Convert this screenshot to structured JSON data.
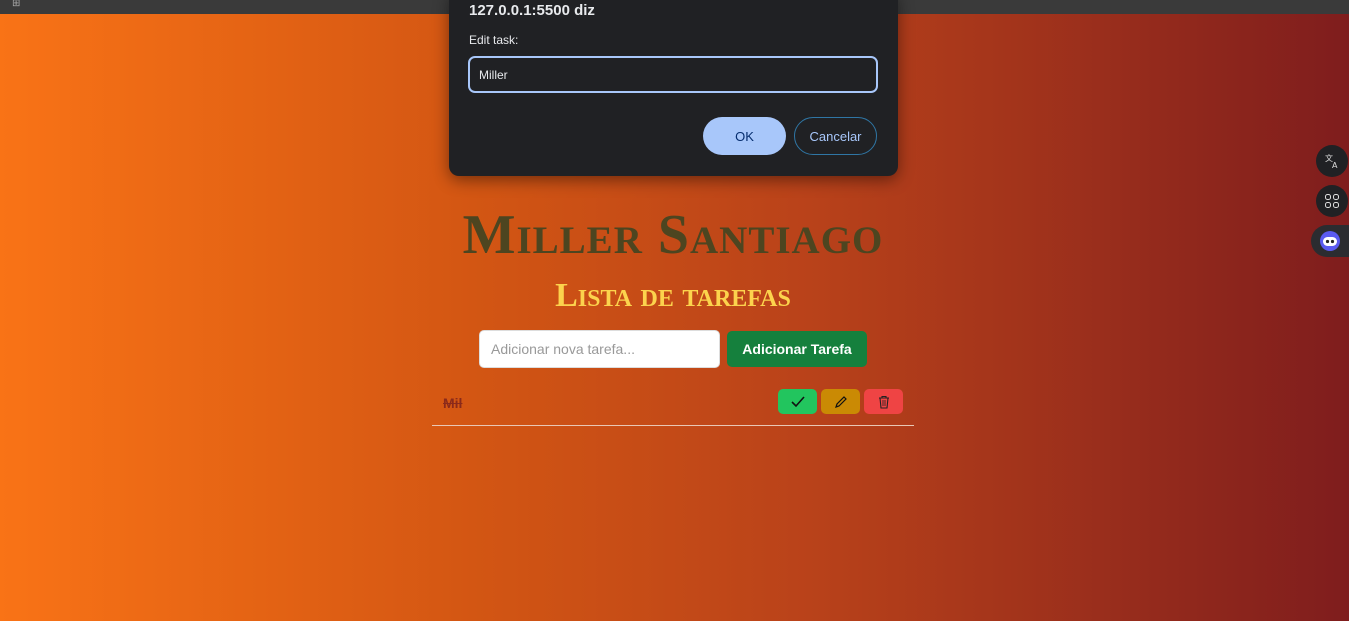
{
  "dialog": {
    "title": "127.0.0.1:5500 diz",
    "label": "Edit task:",
    "input_value": "Miller",
    "ok_label": "OK",
    "cancel_label": "Cancelar"
  },
  "app": {
    "title": "Miller Santiago",
    "subtitle": "Lista de tarefas",
    "input_placeholder": "Adicionar nova tarefa...",
    "add_button_label": "Adicionar Tarefa"
  },
  "tasks": [
    {
      "text": "Mil",
      "completed": true
    }
  ],
  "icons": {
    "complete": "check-icon",
    "edit": "pencil-icon",
    "delete": "trash-icon",
    "translate": "translate-icon",
    "apps": "apps-icon",
    "assistant": "assistant-icon"
  },
  "colors": {
    "background_start": "#f97316",
    "background_end": "#7f1d1d",
    "title": "#4d4520",
    "subtitle": "#fcd34d",
    "add_button": "#15803d",
    "complete_button": "#22c55e",
    "edit_button": "#ca8a04",
    "delete_button": "#ef4444"
  }
}
